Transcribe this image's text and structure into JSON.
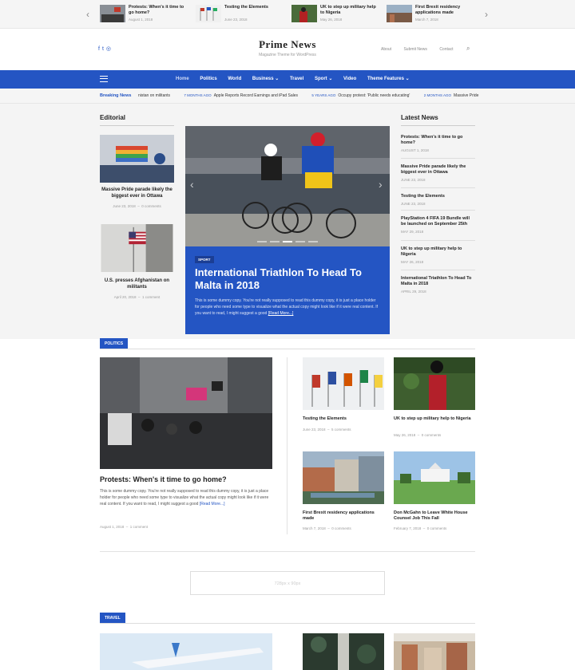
{
  "ticker": {
    "prev_icon": "chevron-left-icon",
    "next_icon": "chevron-right-icon",
    "items": [
      {
        "title": "Protests: When's it time to go home?",
        "date": "August 1, 2018"
      },
      {
        "title": "Testing the Elements",
        "date": "June 23, 2018"
      },
      {
        "title": "UK to step up military help to Nigeria",
        "date": "May 26, 2018"
      },
      {
        "title": "First Brexit residency applications made",
        "date": "March 7, 2018"
      }
    ]
  },
  "header": {
    "site_title": "Prime News",
    "tagline": "Magazine Theme for WordPress",
    "social_icons": [
      "facebook-icon",
      "twitter-icon",
      "instagram-icon"
    ],
    "top_links": [
      "About",
      "Submit News",
      "Contact"
    ],
    "search_icon": "search-icon"
  },
  "nav": {
    "items": [
      "Home",
      "Politics",
      "World",
      "Business ⌄",
      "Travel",
      "Sport ⌄",
      "Video",
      "Theme Features ⌄"
    ]
  },
  "breaking": {
    "label": "Breaking News",
    "items": [
      {
        "ago": "",
        "text": "nistan on militants"
      },
      {
        "ago": "7 MONTHS AGO",
        "text": "Apple Reports Record Earnings and iPad Sales"
      },
      {
        "ago": "5 YEARS AGO",
        "text": "Occupy protest: 'Public needs educating'"
      },
      {
        "ago": "2 MONTHS AGO",
        "text": "Massive Pride"
      }
    ]
  },
  "editorial": {
    "title": "Editorial",
    "posts": [
      {
        "title": "Massive Pride parade likely the biggest ever in Ottawa",
        "date": "June 23, 2018",
        "comments": "0 comments"
      },
      {
        "title": "U.S. presses Afghanistan on militants",
        "date": "April 20, 2018",
        "comments": "1 comment"
      }
    ]
  },
  "slider": {
    "category": "SPORT",
    "title": "International Triathlon To Head To Malta in 2018",
    "excerpt": "This is some dummy copy. You're not really supposed to read this dummy copy, it is just a place holder for people who need some type to visualize what the actual copy might look like if it were real content. If you want to read, I might suggest a good",
    "read_more": "[Read More...]"
  },
  "latest": {
    "title": "Latest News",
    "posts": [
      {
        "title": "Protests: When's it time to go home?",
        "date": "AUGUST 1, 2018"
      },
      {
        "title": "Massive Pride parade likely the biggest ever in Ottawa",
        "date": "JUNE 23, 2018"
      },
      {
        "title": "Testing the Elements",
        "date": "JUNE 23, 2018"
      },
      {
        "title": "PlayStation 4 FIFA 19 Bundle will be launched on September 25th",
        "date": "MAY 29, 2018"
      },
      {
        "title": "UK to step up military help to Nigeria",
        "date": "MAY 26, 2018"
      },
      {
        "title": "International Triathlon To Head To Malta in 2018",
        "date": "APRIL 29, 2018"
      }
    ]
  },
  "politics": {
    "label": "POLITICS",
    "main": {
      "title": "Protests: When's it time to go home?",
      "excerpt": "This is some dummy copy. You're not really supposed to read this dummy copy, it is just a place holder for people who need some type to visualize what the actual copy might look like if it were real content. If you want to read, I might suggest a good",
      "read_more": "[Read More...]",
      "date": "August 1, 2018",
      "comments": "1 comment"
    },
    "grid": [
      {
        "title": "Testing the Elements",
        "date": "June 23, 2018",
        "comments": "5 comments"
      },
      {
        "title": "UK to step up military help to Nigeria",
        "date": "May 26, 2018",
        "comments": "0 comments"
      },
      {
        "title": "First Brexit residency applications made",
        "date": "March 7, 2018",
        "comments": "0 comments"
      },
      {
        "title": "Don McGahn to Leave White House Counsel Job This Fall",
        "date": "February 7, 2018",
        "comments": "0 comments"
      }
    ]
  },
  "ad": {
    "text": "728px x 90px"
  },
  "travel": {
    "label": "TRAVEL"
  },
  "colors": {
    "accent": "#2455c3",
    "background": "#f4f4f4"
  }
}
